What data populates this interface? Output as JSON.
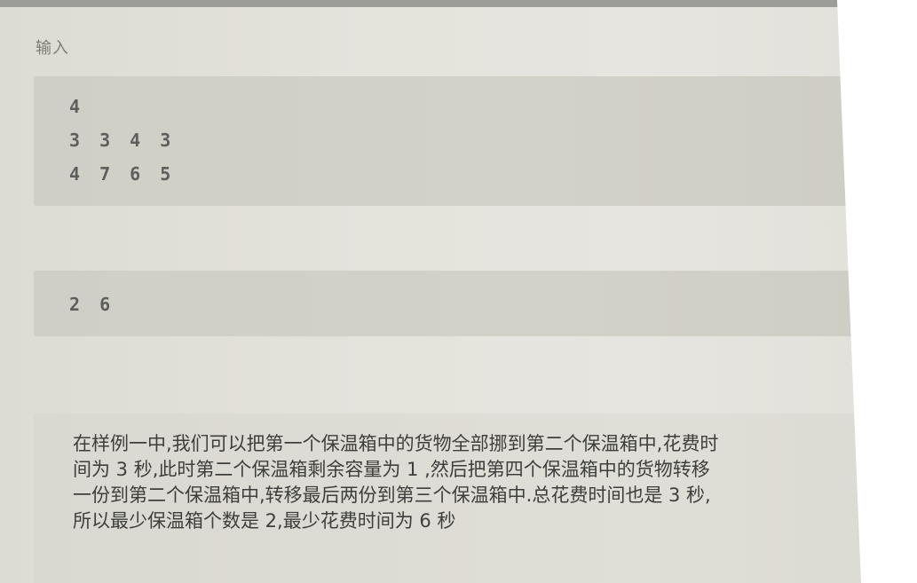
{
  "sample_input": {
    "label": "输入",
    "lines": [
      "4",
      "3 3 4 3",
      "4 7 6 5"
    ]
  },
  "sample_output": {
    "label": "",
    "value": "2 6"
  },
  "explanation": {
    "label": "",
    "text": "在样例一中,我们可以把第一个保温箱中的货物全部挪到第二个保温箱中,花费时\n间为 3 秒,此时第二个保温箱剩余容量为 1 ,然后把第四个保温箱中的货物转移\n一份到第二个保温箱中,转移最后两份到第三个保温箱中.总花费时间也是 3 秒,\n所以最少保温箱个数是 2,最少花费时间为 6 秒"
  }
}
